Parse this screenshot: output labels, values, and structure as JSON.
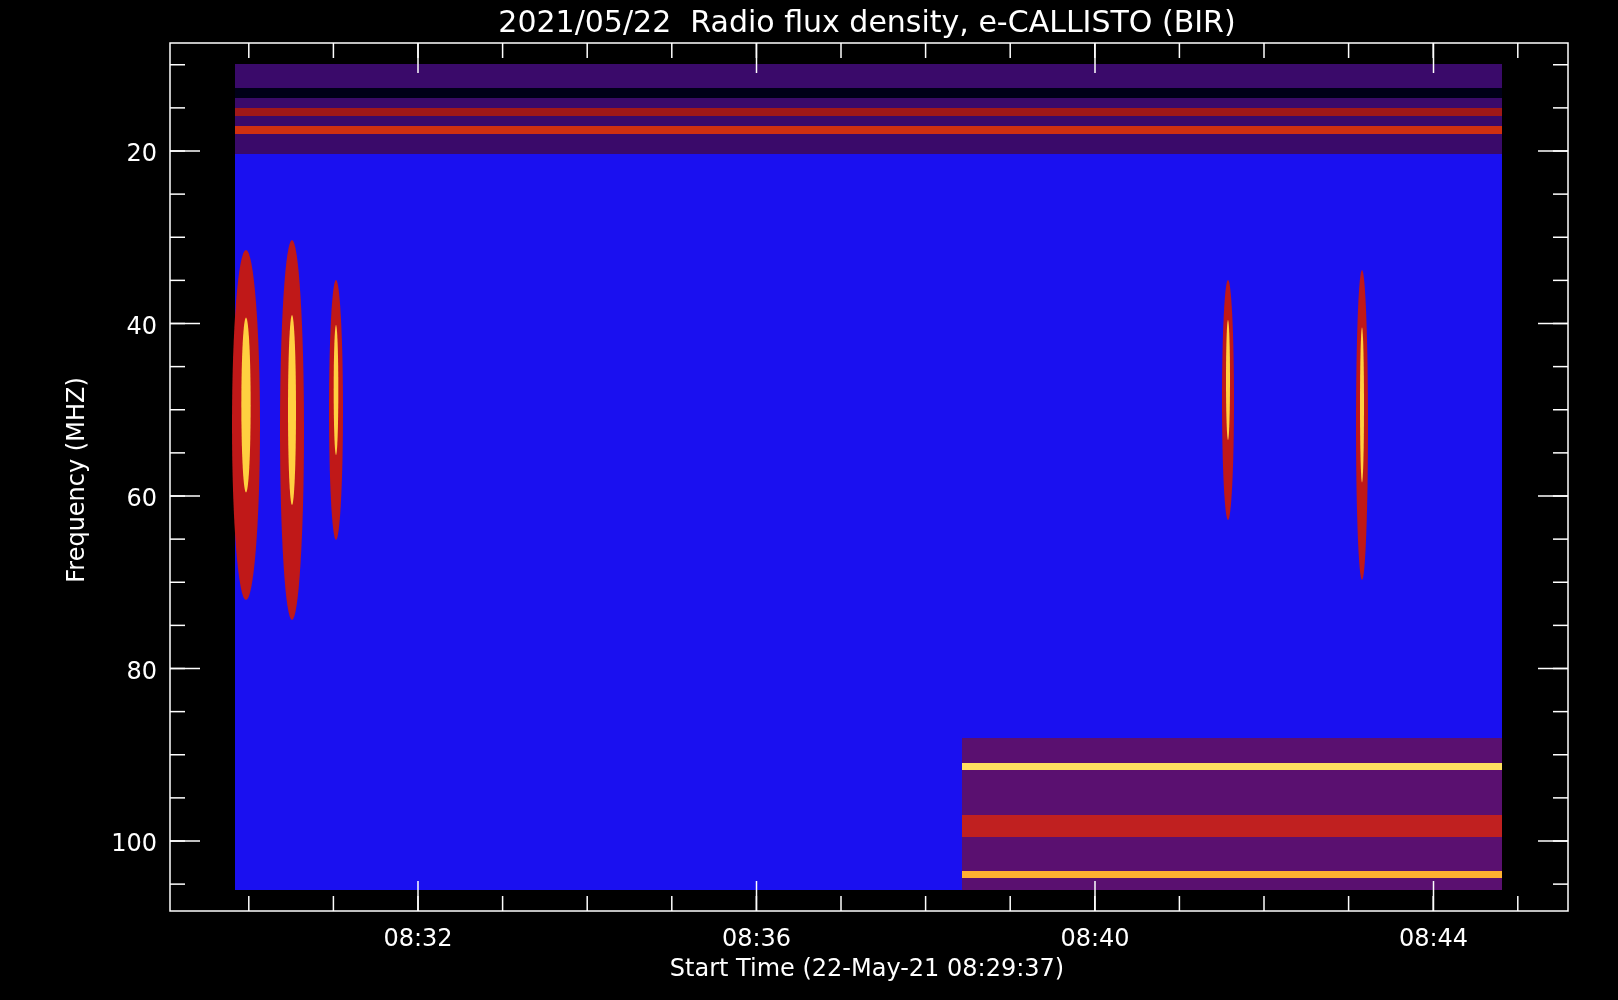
{
  "title": "2021/05/22  Radio flux density, e-CALLISTO (BIR)",
  "y_axis": {
    "label": "Frequency (MHZ)",
    "ticks": [
      "20",
      "40",
      "60",
      "80",
      "100"
    ]
  },
  "x_axis": {
    "label": "Start Time (22-May-21 08:29:37)",
    "ticks": [
      "08:32",
      "08:36",
      "08:40",
      "08:44"
    ]
  }
}
